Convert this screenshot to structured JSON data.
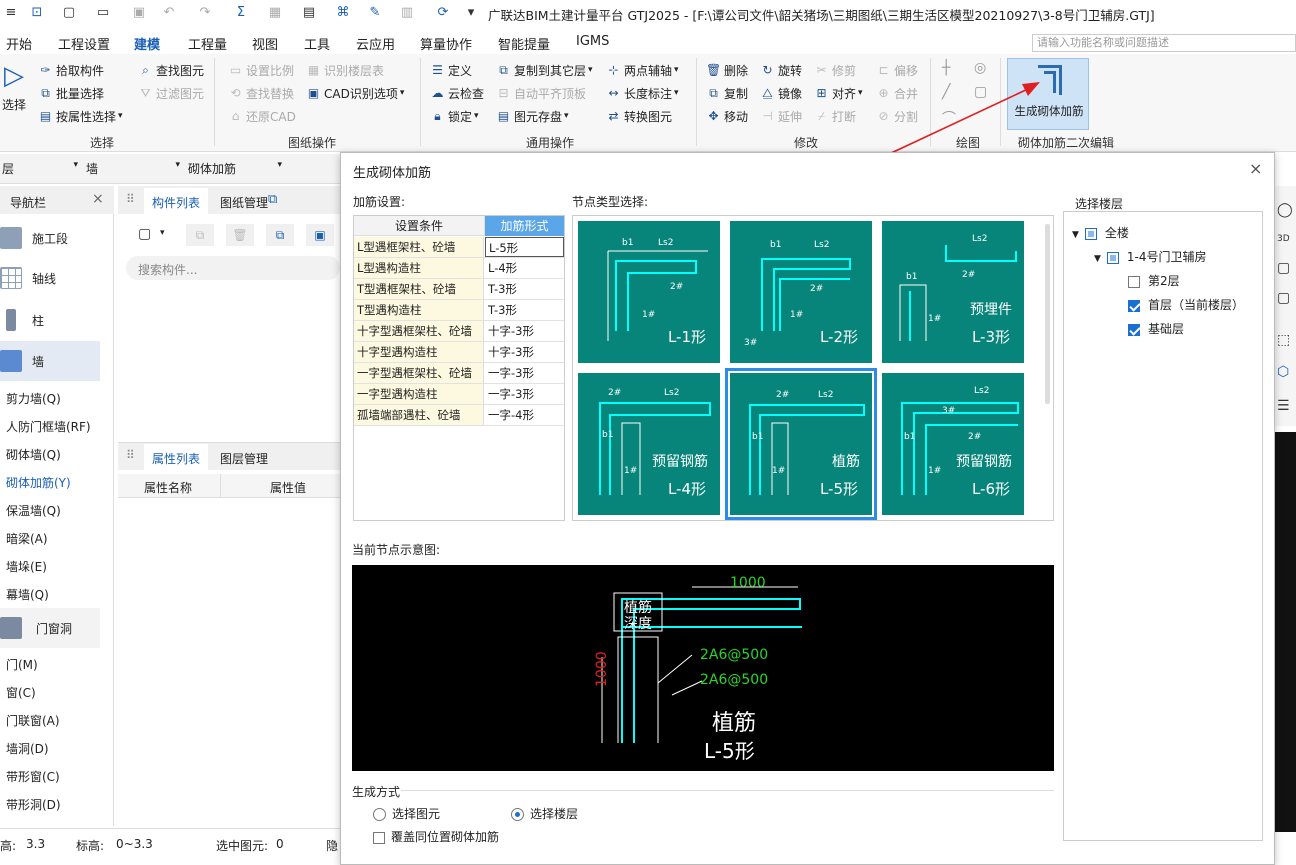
{
  "titlebar": {
    "title": "广联达BIM土建计量平台 GTJ2025 - [F:\\谭公司文件\\韶关猪场\\三期图纸\\三期生活区模型20210927\\3-8号门卫辅房.GTJ]"
  },
  "menu": {
    "tabs": [
      "开始",
      "工程设置",
      "建模",
      "工程量",
      "视图",
      "工具",
      "云应用",
      "算量协作",
      "智能提量",
      "IGMS"
    ],
    "search_placeholder": "请输入功能名称或问题描述"
  },
  "ribbon": {
    "select_label": "选择",
    "select_items": [
      "拾取构件",
      "批量选择",
      "按属性选择"
    ],
    "select_group": "选择",
    "drawing_items": [
      "查找图元",
      "过滤图元",
      "设置比例",
      "查找替换",
      "还原CAD",
      "识别楼层表",
      "CAD识别选项"
    ],
    "drawing_group": "图纸操作",
    "common_items": [
      "定义",
      "云检查",
      "锁定",
      "复制到其它层",
      "自动平齐顶板",
      "图元存盘",
      "两点辅轴",
      "长度标注",
      "转换图元"
    ],
    "common_group": "通用操作",
    "modify_items": [
      "删除",
      "复制",
      "移动",
      "旋转",
      "镜像",
      "延伸",
      "修剪",
      "对齐",
      "打断",
      "偏移",
      "合并",
      "分割"
    ],
    "modify_group": "修改",
    "draw_group": "绘图",
    "big_button": "生成砌体加筋",
    "secondary_group": "砌体加筋二次编辑"
  },
  "selectors": {
    "floor": "层",
    "type": "墙",
    "sub": "砌体加筋"
  },
  "nav": {
    "title": "导航栏",
    "big_items": [
      "施工段",
      "轴线",
      "柱",
      "墙",
      "门窗洞"
    ],
    "wall_items": [
      "剪力墙(Q)",
      "人防门框墙(RF)",
      "砌体墙(Q)",
      "砌体加筋(Y)",
      "保温墙(Q)",
      "暗梁(A)",
      "墙垛(E)",
      "幕墙(Q)"
    ],
    "door_items": [
      "门(M)",
      "窗(C)",
      "门联窗(A)",
      "墙洞(D)",
      "带形窗(C)",
      "带形洞(D)"
    ]
  },
  "comp_panel": {
    "tab1": "构件列表",
    "tab2": "图纸管理",
    "search_placeholder": "搜索构件...",
    "tab3": "属性列表",
    "tab4": "图层管理",
    "col1": "属性名称",
    "col2": "属性值"
  },
  "status": {
    "height_label": "高:",
    "height_value": "3.3",
    "elev_label": "标高:",
    "elev_value": "0~3.3",
    "selected_label": "选中图元:",
    "selected_value": "0",
    "hidden": "隐"
  },
  "dialog": {
    "title": "生成砌体加筋",
    "settings_label": "加筋设置:",
    "col_condition": "设置条件",
    "col_form": "加筋形式",
    "rows": [
      {
        "cond": "L型遇框架柱、砼墙",
        "form": "L-5形"
      },
      {
        "cond": "L型遇构造柱",
        "form": "L-4形"
      },
      {
        "cond": "T型遇框架柱、砼墙",
        "form": "T-3形"
      },
      {
        "cond": "T型遇构造柱",
        "form": "T-3形"
      },
      {
        "cond": "十字型遇框架柱、砼墙",
        "form": "十字-3形"
      },
      {
        "cond": "十字型遇构造柱",
        "form": "十字-3形"
      },
      {
        "cond": "一字型遇框架柱、砼墙",
        "form": "一字-3形"
      },
      {
        "cond": "一字型遇构造柱",
        "form": "一字-3形"
      },
      {
        "cond": "孤墙端部遇柱、砼墙",
        "form": "一字-4形"
      }
    ],
    "node_label": "节点类型选择:",
    "nodes": [
      {
        "name": "L-1形",
        "extra": ""
      },
      {
        "name": "L-2形",
        "extra": ""
      },
      {
        "name": "L-3形",
        "extra": "预埋件"
      },
      {
        "name": "L-4形",
        "extra": "预留钢筋"
      },
      {
        "name": "L-5形",
        "extra": "植筋"
      },
      {
        "name": "L-6形",
        "extra": "预留钢筋"
      }
    ],
    "preview_label": "当前节点示意图:",
    "preview": {
      "len_top": "1000",
      "len_side": "1000",
      "depth_label1": "植筋",
      "depth_label2": "深度",
      "bar1": "2A6@500",
      "bar2": "2A6@500",
      "name1": "植筋",
      "name2": "L-5形"
    },
    "gen_label": "生成方式",
    "opt1": "选择图元",
    "opt2": "选择楼层",
    "overwrite": "覆盖同位置砌体加筋",
    "floor_label": "选择楼层",
    "floors": {
      "all": "全楼",
      "building": "1-4号门卫辅房",
      "f2": "第2层",
      "f1": "首层（当前楼层）",
      "base": "基础层"
    }
  }
}
